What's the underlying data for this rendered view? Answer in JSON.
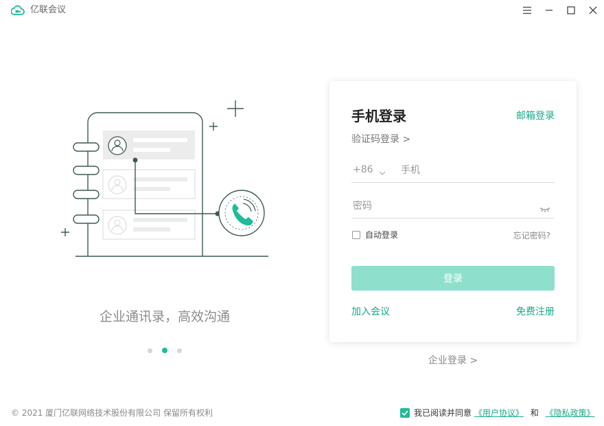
{
  "app": {
    "title": "亿联会议"
  },
  "window_controls": {
    "menu_icon": "menu-icon",
    "minimize_icon": "minimize-icon",
    "maximize_icon": "maximize-icon",
    "close_icon": "close-icon"
  },
  "carousel": {
    "slogan": "企业通讯录，高效沟通",
    "pages": 3,
    "active_index": 1
  },
  "login": {
    "title": "手机登录",
    "email_login": "邮箱登录",
    "code_login": "验证码登录 >",
    "country_code": "+86",
    "phone_placeholder": "手机",
    "password_placeholder": "密码",
    "auto_login": "自动登录",
    "auto_login_checked": false,
    "forgot_password": "忘记密码?",
    "submit": "登录",
    "join_meeting": "加入会议",
    "register": "免费注册"
  },
  "enterprise_login": "企业登录 >",
  "footer": {
    "copyright": "© 2021 厦门亿联网络技术股份有限公司 保留所有权利",
    "agree_checked": true,
    "agree_prefix": "我已阅读并同意",
    "user_agreement": "《用户协议》",
    "and": "和",
    "privacy_policy": "《隐私政策》"
  },
  "colors": {
    "accent": "#1fbb9a",
    "link": "#1aa88a",
    "button_disabled": "#8ee0cd",
    "illustration_line": "#3d5a50"
  }
}
